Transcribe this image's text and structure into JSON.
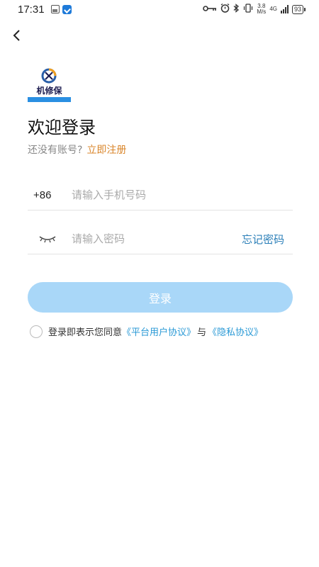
{
  "status_bar": {
    "time": "17:31",
    "speed_value": "3.8",
    "speed_unit": "M/s",
    "network_type": "4G",
    "battery": "93",
    "icons": [
      "image-icon",
      "app-notification-icon",
      "key-icon",
      "alarm-icon",
      "bluetooth-icon",
      "vibrate-icon",
      "signal-icon",
      "battery-icon"
    ]
  },
  "header": {
    "back_icon": "chevron-left-icon"
  },
  "logo": {
    "text": "机修保",
    "colors": {
      "bar": "#2a8fe2",
      "circle": "#f0a020",
      "text": "#1b1b4f"
    }
  },
  "login": {
    "title": "欢迎登录",
    "no_account_text": "还没有账号?",
    "register_link": "立即注册",
    "country_code": "+86",
    "phone_placeholder": "请输入手机号码",
    "phone_value": "",
    "password_placeholder": "请输入密码",
    "password_value": "",
    "eye_icon": "eye-closed-icon",
    "forgot_password": "忘记密码",
    "login_button": "登录",
    "agreement_prefix": "登录即表示您同意",
    "user_agreement": "《平台用户协议》",
    "and_text": "与",
    "privacy_agreement": "《隐私协议》",
    "agreement_checked": false
  },
  "colors": {
    "accent_orange": "#d9852a",
    "link_blue": "#2b9ad6",
    "button_disabled": "#a9d7f8",
    "forgot_blue": "#2b7fb8"
  }
}
